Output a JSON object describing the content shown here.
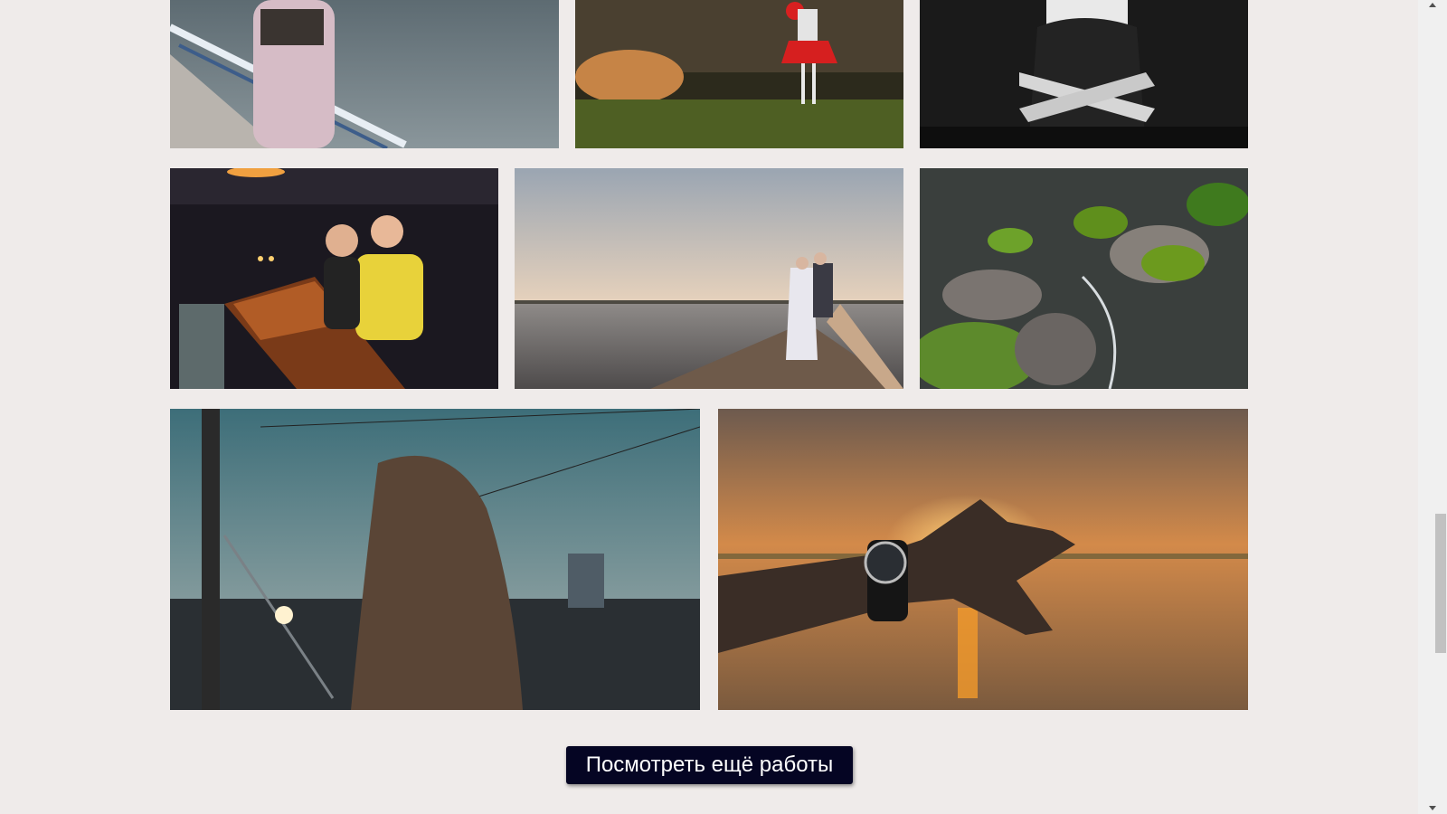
{
  "gallery": {
    "photos": [
      {
        "alt": "woman-in-pink-coat-by-river"
      },
      {
        "alt": "clown-girl-with-red-balloon"
      },
      {
        "alt": "black-white-woman-crossed-arms"
      },
      {
        "alt": "two-women-at-bar"
      },
      {
        "alt": "wedding-couple-on-pier"
      },
      {
        "alt": "mossy-rocks-stream"
      },
      {
        "alt": "woman-on-bridge-at-dusk"
      },
      {
        "alt": "hand-with-watch-at-sunset"
      }
    ]
  },
  "actions": {
    "more_works_label": "Посмотреть ещё работы"
  },
  "colors": {
    "background": "#efebea",
    "button_bg": "#050523",
    "button_text": "#ffffff"
  }
}
